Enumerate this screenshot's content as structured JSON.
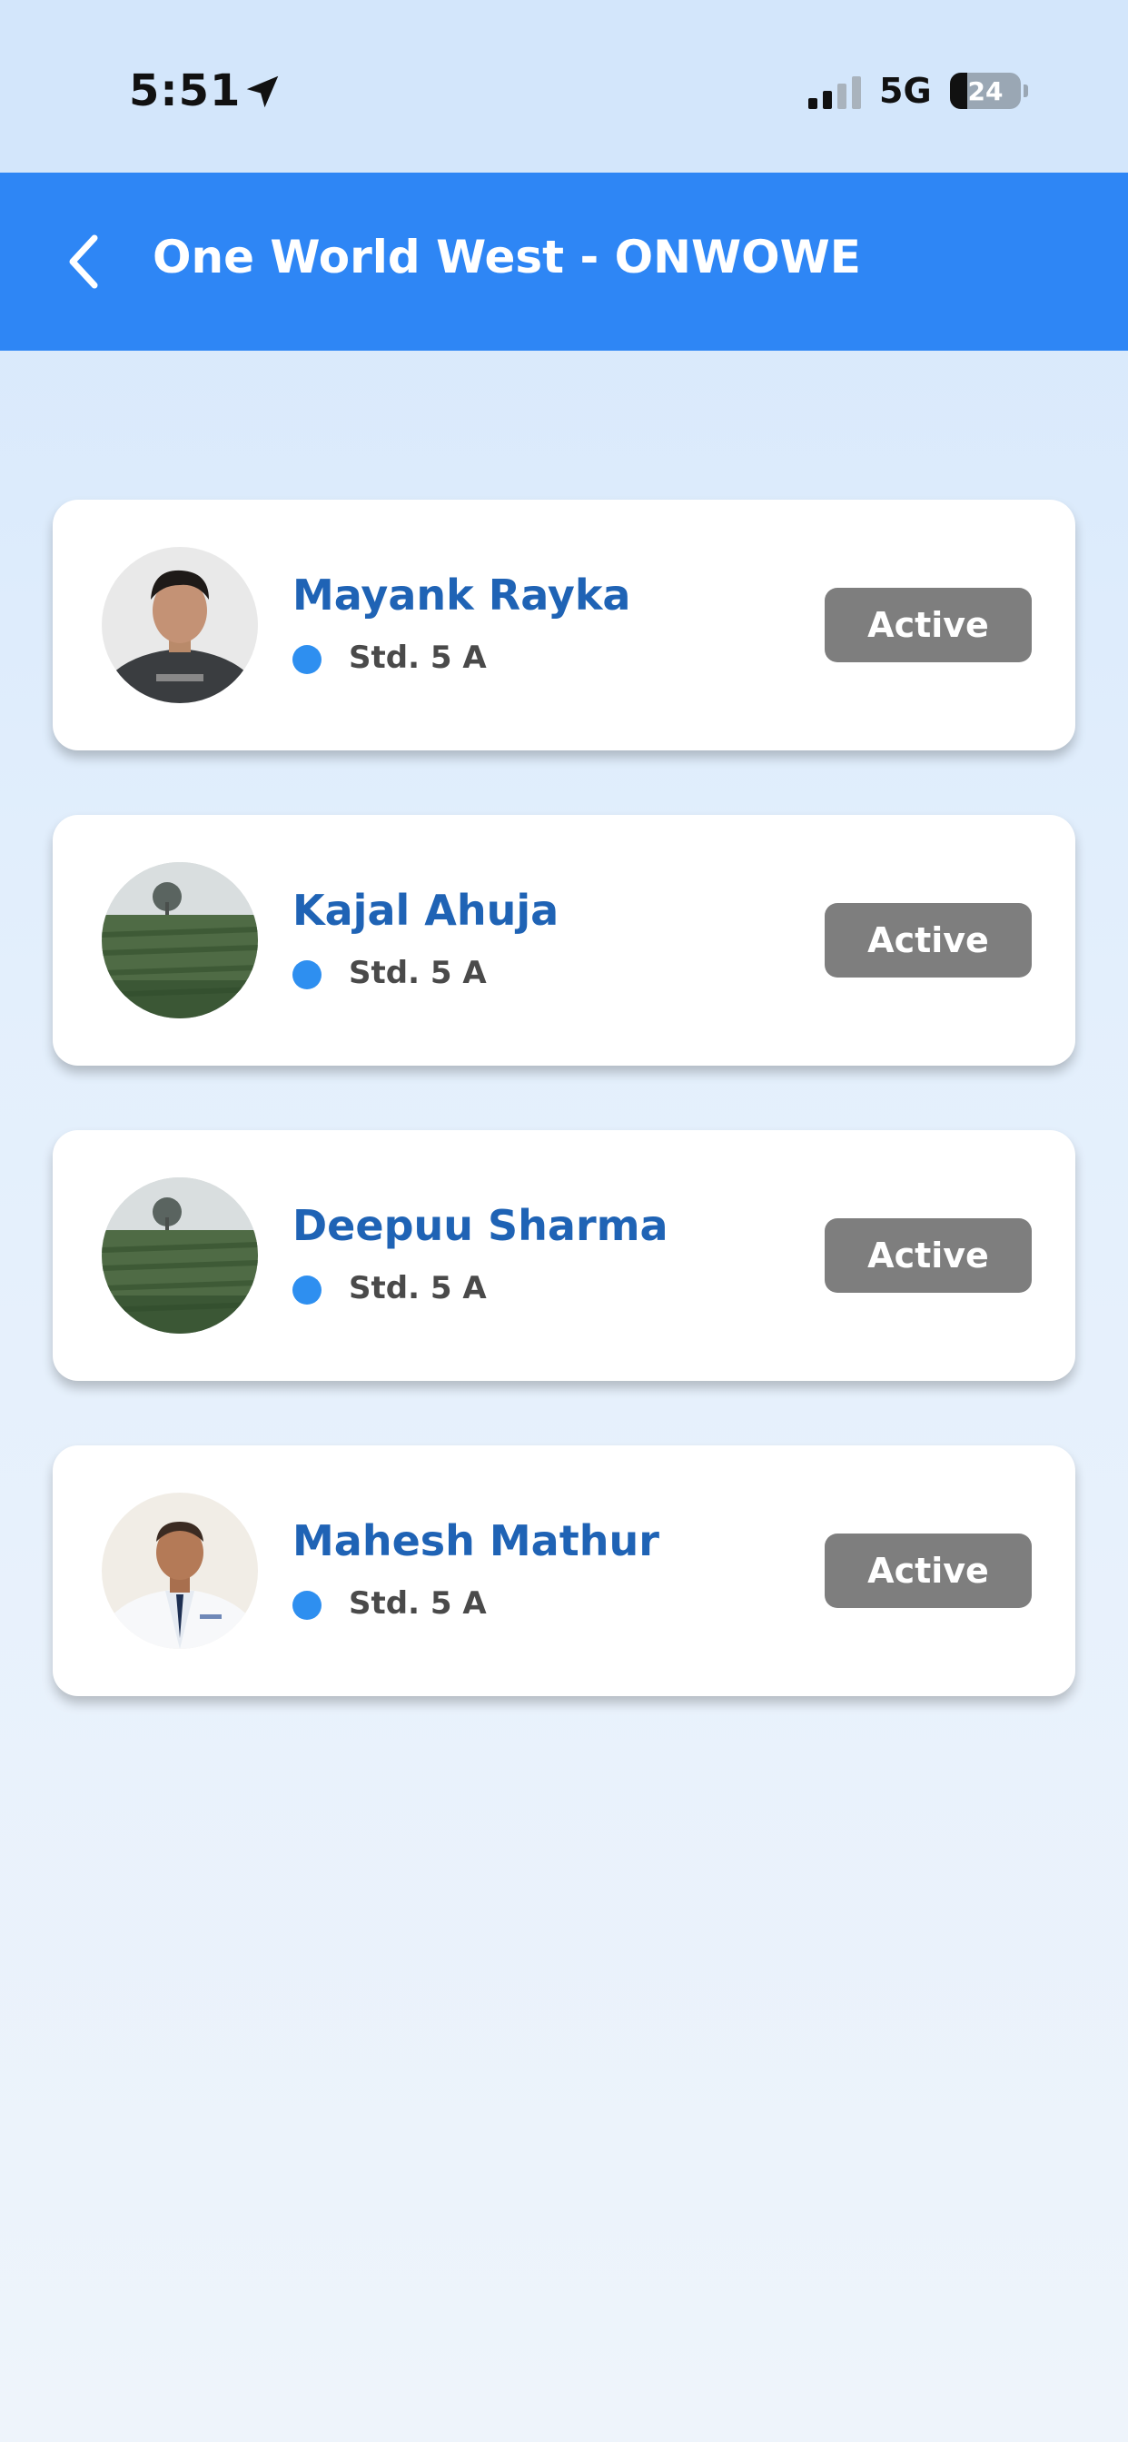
{
  "status_bar": {
    "time": "5:51",
    "network": "5G",
    "battery_level": "24",
    "battery_fraction": 0.24,
    "location_icon": "location-arrow-icon",
    "signal_icon": "signal-bars-icon"
  },
  "header": {
    "title": "One World West - ONWOWE",
    "back_icon": "chevron-left-icon",
    "background_color": "#2e86f5"
  },
  "students": [
    {
      "name": "Mayank Rayka",
      "class": "Std. 5 A",
      "status": "Active",
      "avatar": "person-photo"
    },
    {
      "name": "Kajal Ahuja",
      "class": "Std. 5 A",
      "status": "Active",
      "avatar": "field-photo"
    },
    {
      "name": "Deepuu Sharma",
      "class": "Std. 5 A",
      "status": "Active",
      "avatar": "field-photo"
    },
    {
      "name": "Mahesh Mathur",
      "class": "Std. 5 A",
      "status": "Active",
      "avatar": "doctor-photo"
    }
  ],
  "colors": {
    "name_text": "#1f63b5",
    "class_dot": "#2e8ff0",
    "status_badge": "#7e7e7e"
  }
}
